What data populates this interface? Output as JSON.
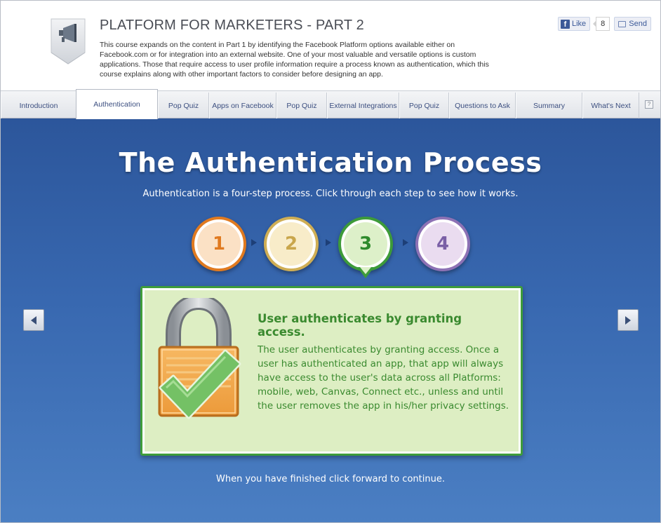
{
  "header": {
    "title": "PLATFORM FOR MARKETERS - PART 2",
    "description": "This course expands on the content in Part 1 by identifying the Facebook Platform options available either on Facebook.com or for integration into an external website. One of your most valuable and versatile options is custom applications. Those that require access to user profile information require a process known as authentication, which this course explains along with other important factors to consider before designing an app.",
    "icon": "megaphone-icon",
    "social": {
      "like_label": "Like",
      "like_count": "8",
      "send_label": "Send"
    }
  },
  "tabs": [
    {
      "label": "Introduction",
      "active": false
    },
    {
      "label": "Authentication",
      "active": true
    },
    {
      "label": "Pop Quiz",
      "active": false
    },
    {
      "label": "Apps on Facebook",
      "active": false
    },
    {
      "label": "Pop Quiz",
      "active": false
    },
    {
      "label": "External Integrations",
      "active": false
    },
    {
      "label": "Pop Quiz",
      "active": false
    },
    {
      "label": "Questions to Ask",
      "active": false
    },
    {
      "label": "Summary",
      "active": false
    },
    {
      "label": "What's Next",
      "active": false
    }
  ],
  "help_label": "?",
  "main": {
    "title": "The Authentication Process",
    "subtitle": "Authentication is a four-step process. Click through each step to see how it works.",
    "steps": [
      "1",
      "2",
      "3",
      "4"
    ],
    "current_step": 3,
    "step_colors": [
      "#e07a20",
      "#cfae55",
      "#3d9b3a",
      "#8d72b5"
    ],
    "box": {
      "heading": "User authenticates by granting access.",
      "body": "The user authenticates by granting access. Once a user has authenticated an app, that app will always have access to the user's data across all Platforms: mobile, web, Canvas, Connect etc., unless and until the user removes the app in his/her privacy settings.",
      "icon": "padlock-checkmark-icon"
    },
    "footer": "When you have finished click forward to continue."
  },
  "colors": {
    "stage_top": "#2c569b",
    "stage_bottom": "#4b7fc3",
    "box_bg": "#ddeec3",
    "box_border": "#3f9d3a",
    "box_text": "#3a8a2f"
  }
}
